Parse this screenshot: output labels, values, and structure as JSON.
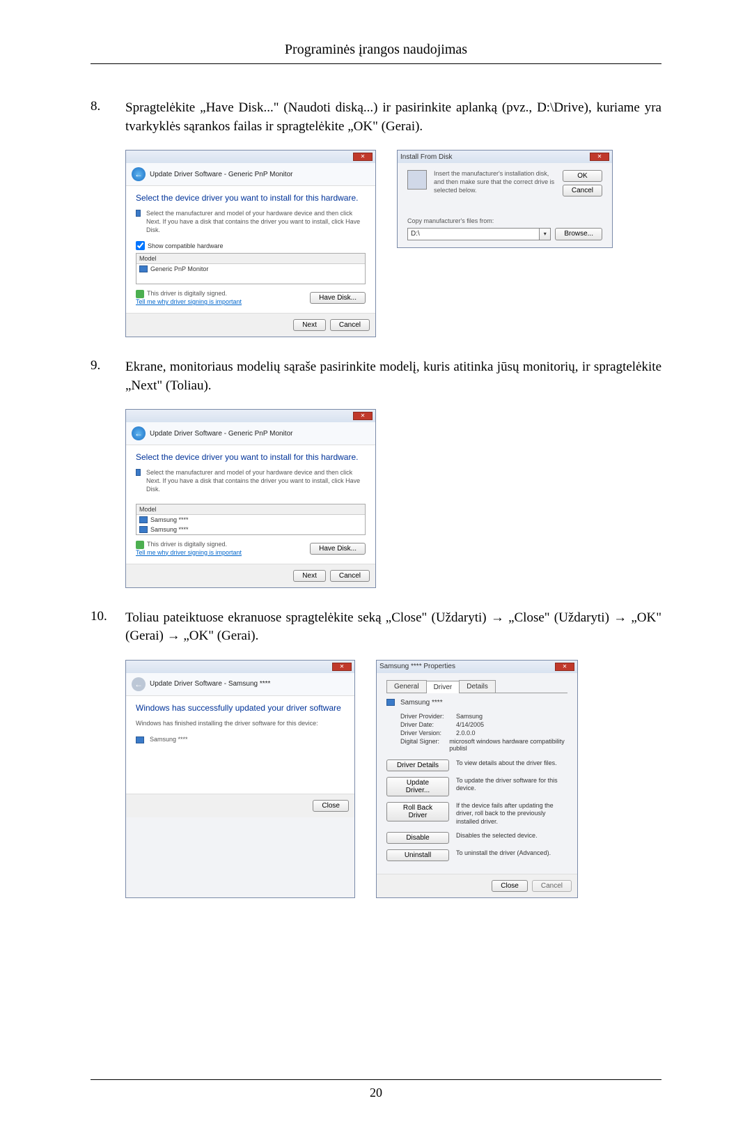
{
  "header": {
    "title": "Programinės įrangos naudojimas"
  },
  "steps": {
    "s8": {
      "num": "8.",
      "text": "Spragtelėkite „Have Disk...\" (Naudoti diską...) ir pasirinkite aplanką (pvz., D:\\Drive), kuriame yra tvarkyklės sąrankos failas ir spragtelėkite „OK\" (Gerai)."
    },
    "s9": {
      "num": "9.",
      "text": "Ekrane, monitoriaus modelių sąraše pasirinkite modelį, kuris atitinka jūsų monitorių, ir spragtelėkite „Next\" (Toliau)."
    },
    "s10": {
      "num": "10.",
      "text": "Toliau pateiktuose ekranuose spragtelėkite seką „Close\" (Uždaryti)  →  „Close\" (Uždaryti)  →  „OK\" (Gerai)  →  „OK\" (Gerai)."
    }
  },
  "dlgA": {
    "breadcrumb": "Update Driver Software - Generic PnP Monitor",
    "heading": "Select the device driver you want to install for this hardware.",
    "desc": "Select the manufacturer and model of your hardware device and then click Next. If you have a disk that contains the driver you want to install, click Have Disk.",
    "checkbox": "Show compatible hardware",
    "listHeader": "Model",
    "listItem": "Generic PnP Monitor",
    "signed": "This driver is digitally signed.",
    "signedLink": "Tell me why driver signing is important",
    "haveDisk": "Have Disk...",
    "next": "Next",
    "cancel": "Cancel"
  },
  "dlgB": {
    "title": "Install From Disk",
    "msg": "Insert the manufacturer's installation disk, and then make sure that the correct drive is selected below.",
    "ok": "OK",
    "cancel": "Cancel",
    "copyLabel": "Copy manufacturer's files from:",
    "path": "D:\\",
    "browse": "Browse..."
  },
  "dlgC": {
    "breadcrumb": "Update Driver Software - Generic PnP Monitor",
    "heading": "Select the device driver you want to install for this hardware.",
    "desc": "Select the manufacturer and model of your hardware device and then click Next. If you have a disk that contains the driver you want to install, click Have Disk.",
    "listHeader": "Model",
    "item1": "Samsung ****",
    "item2": "Samsung ****",
    "signed": "This driver is digitally signed.",
    "signedLink": "Tell me why driver signing is important",
    "haveDisk": "Have Disk...",
    "next": "Next",
    "cancel": "Cancel"
  },
  "dlgD": {
    "breadcrumb": "Update Driver Software - Samsung ****",
    "heading": "Windows has successfully updated your driver software",
    "desc": "Windows has finished installing the driver software for this device:",
    "device": "Samsung ****",
    "close": "Close"
  },
  "dlgE": {
    "title": "Samsung **** Properties",
    "tabs": {
      "general": "General",
      "driver": "Driver",
      "details": "Details"
    },
    "device": "Samsung ****",
    "provider": {
      "label": "Driver Provider:",
      "value": "Samsung"
    },
    "date": {
      "label": "Driver Date:",
      "value": "4/14/2005"
    },
    "version": {
      "label": "Driver Version:",
      "value": "2.0.0.0"
    },
    "signer": {
      "label": "Digital Signer:",
      "value": "microsoft windows hardware compatibility publisl"
    },
    "driverDetails": {
      "btn": "Driver Details",
      "desc": "To view details about the driver files."
    },
    "updateDriver": {
      "btn": "Update Driver...",
      "desc": "To update the driver software for this device."
    },
    "rollBack": {
      "btn": "Roll Back Driver",
      "desc": "If the device fails after updating the driver, roll back to the previously installed driver."
    },
    "disable": {
      "btn": "Disable",
      "desc": "Disables the selected device."
    },
    "uninstall": {
      "btn": "Uninstall",
      "desc": "To uninstall the driver (Advanced)."
    },
    "close": "Close",
    "cancel": "Cancel"
  },
  "footer": {
    "pageNum": "20"
  }
}
